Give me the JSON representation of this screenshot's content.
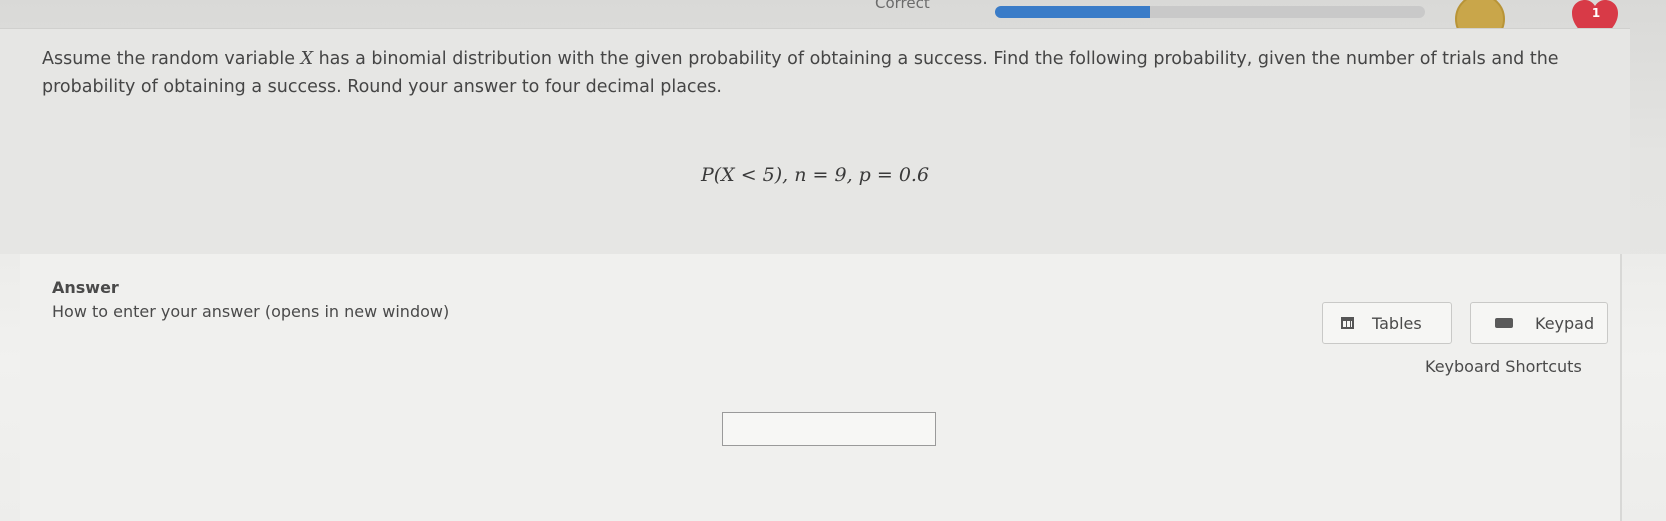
{
  "status": {
    "label": "Correct",
    "progress_fraction": 0.36,
    "lives": "1"
  },
  "question": {
    "text_before": "Assume the random variable ",
    "variable": "X",
    "text_after": " has a binomial distribution with the given probability of obtaining a success. Find the following probability, given the number of trials and the probability of obtaining a success. Round your answer to four decimal places.",
    "formula": "P(X < 5), n = 9, p = 0.6"
  },
  "answer": {
    "heading": "Answer",
    "howto_link": "How to enter your answer (opens in new window)",
    "tables_label": "Tables",
    "keypad_label": "Keypad",
    "shortcuts_label": "Keyboard Shortcuts",
    "input_value": ""
  },
  "colors": {
    "progress": "#3a7cc8",
    "heart": "#d83a47",
    "coin": "#c9a64a"
  }
}
